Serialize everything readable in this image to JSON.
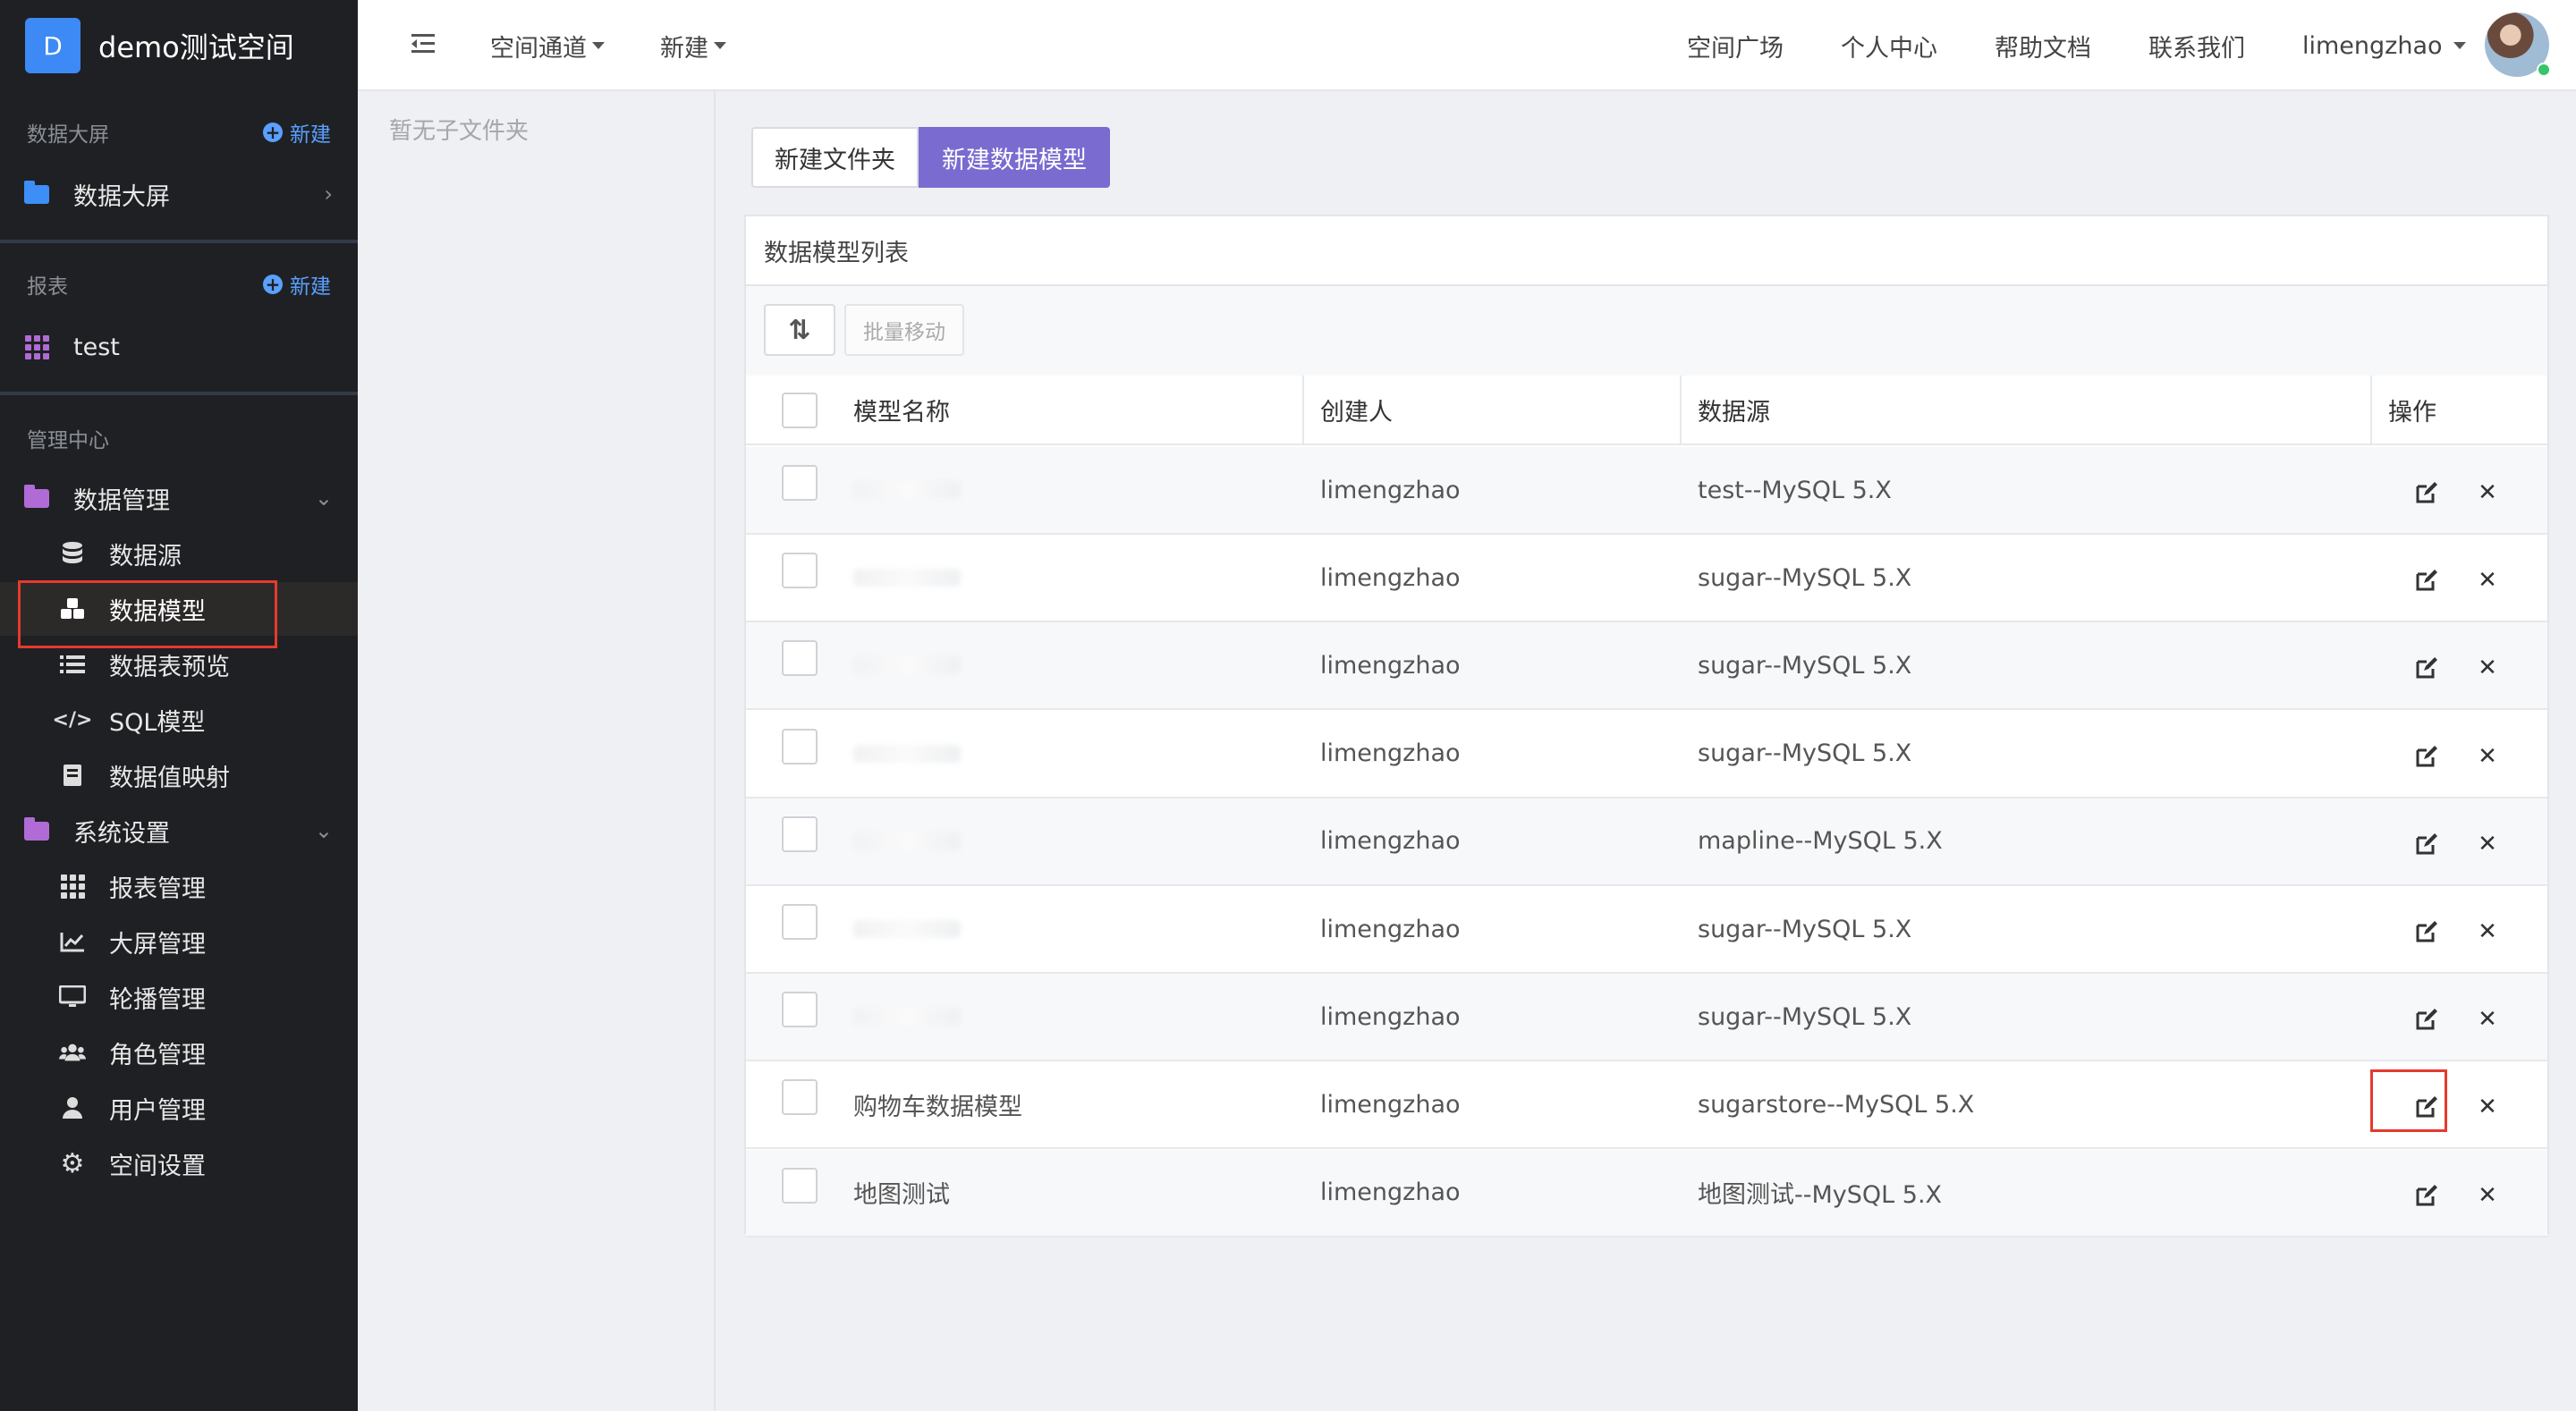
{
  "brand": {
    "logo_letter": "D",
    "name": "demo测试空间"
  },
  "sidebar": {
    "section_bigscreen": {
      "title": "数据大屏",
      "new_label": "新建"
    },
    "bigscreen_item": "数据大屏",
    "section_report": {
      "title": "报表",
      "new_label": "新建"
    },
    "report_item": "test",
    "section_admin": {
      "title": "管理中心"
    },
    "data_mgmt": "数据管理",
    "data_mgmt_children": [
      "数据源",
      "数据模型",
      "数据表预览",
      "SQL模型",
      "数据值映射"
    ],
    "sys_settings": "系统设置",
    "sys_children": [
      "报表管理",
      "大屏管理",
      "轮播管理",
      "角色管理",
      "用户管理",
      "空间设置"
    ],
    "active_item": "数据模型"
  },
  "topbar": {
    "left_menu": [
      "空间通道",
      "新建"
    ],
    "right_links": [
      "空间广场",
      "个人中心",
      "帮助文档",
      "联系我们"
    ],
    "username": "limengzhao"
  },
  "folder_panel": {
    "empty_text": "暂无子文件夹"
  },
  "main": {
    "tabs": {
      "new_folder": "新建文件夹",
      "new_model": "新建数据模型"
    },
    "card_title": "数据模型列表",
    "toolbar": {
      "sort_icon": "⇅",
      "batch_move": "批量移动"
    },
    "table": {
      "headers": {
        "name": "模型名称",
        "creator": "创建人",
        "source": "数据源",
        "actions": "操作"
      },
      "rows": [
        {
          "name": "",
          "creator": "limengzhao",
          "source": "test--MySQL 5.X"
        },
        {
          "name": "",
          "creator": "limengzhao",
          "source": "sugar--MySQL 5.X"
        },
        {
          "name": "",
          "creator": "limengzhao",
          "source": "sugar--MySQL 5.X"
        },
        {
          "name": "",
          "creator": "limengzhao",
          "source": "sugar--MySQL 5.X"
        },
        {
          "name": "",
          "creator": "limengzhao",
          "source": "mapline--MySQL 5.X"
        },
        {
          "name": "",
          "creator": "limengzhao",
          "source": "sugar--MySQL 5.X"
        },
        {
          "name": "",
          "creator": "limengzhao",
          "source": "sugar--MySQL 5.X"
        },
        {
          "name": "购物车数据模型",
          "creator": "limengzhao",
          "source": "sugarstore--MySQL 5.X"
        },
        {
          "name": "地图测试",
          "creator": "limengzhao",
          "source": "地图测试--MySQL 5.X"
        }
      ]
    }
  },
  "colors": {
    "sidebar_bg": "#1f2023",
    "accent": "#7a6bd0",
    "link_blue": "#5aa0ff",
    "highlight": "#e53a2f"
  }
}
